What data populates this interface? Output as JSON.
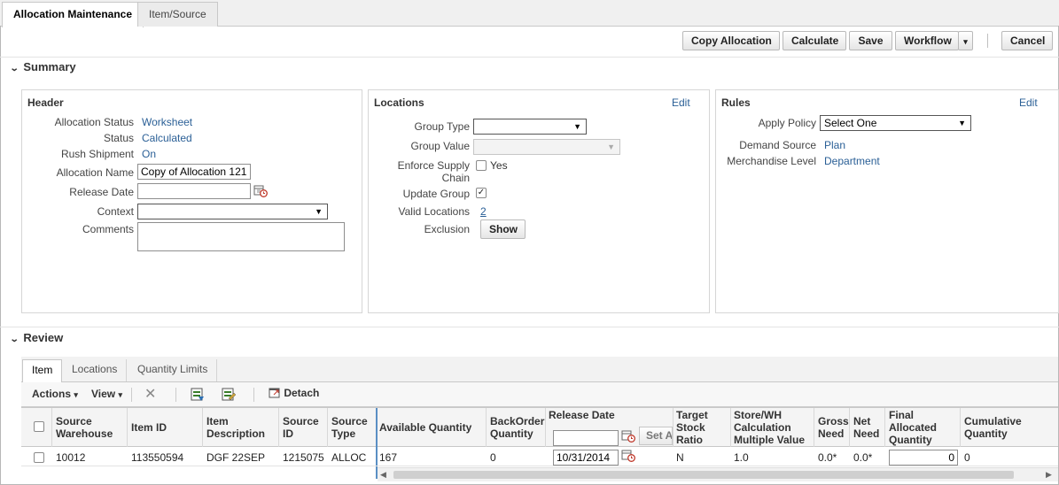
{
  "top_tabs": [
    {
      "label": "Allocation Maintenance"
    },
    {
      "label": "Item/Source"
    }
  ],
  "toolbar": {
    "copy": "Copy Allocation",
    "calculate": "Calculate",
    "save": "Save",
    "workflow": "Workflow",
    "cancel": "Cancel"
  },
  "summary": {
    "title": "Summary",
    "header": {
      "title": "Header",
      "allocation_status_label": "Allocation Status",
      "allocation_status": "Worksheet",
      "status_label": "Status",
      "status": "Calculated",
      "rush_label": "Rush Shipment",
      "rush": "On",
      "name_label": "Allocation Name",
      "name": "Copy of Allocation 121",
      "release_label": "Release Date",
      "release": "",
      "context_label": "Context",
      "context": "",
      "comments_label": "Comments",
      "comments": ""
    },
    "locations": {
      "title": "Locations",
      "edit": "Edit",
      "group_type_label": "Group Type",
      "group_type": "",
      "group_value_label": "Group Value",
      "group_value": "",
      "enforce_label_1": "Enforce Supply",
      "enforce_label_2": "Chain",
      "enforce_yes": "Yes",
      "update_group_label": "Update Group",
      "valid_locations_label": "Valid Locations",
      "valid_locations": "2",
      "exclusion_label": "Exclusion",
      "show": "Show"
    },
    "rules": {
      "title": "Rules",
      "edit": "Edit",
      "apply_policy_label": "Apply Policy",
      "apply_policy": "Select One",
      "demand_source_label": "Demand Source",
      "demand_source": "Plan",
      "merch_level_label": "Merchandise Level",
      "merch_level": "Department"
    }
  },
  "review": {
    "title": "Review",
    "tabs": [
      {
        "label": "Item"
      },
      {
        "label": "Locations"
      },
      {
        "label": "Quantity Limits"
      }
    ],
    "actions": "Actions",
    "view": "View",
    "detach": "Detach",
    "columns": {
      "source_warehouse": [
        "Source",
        "Warehouse"
      ],
      "item_id": "Item ID",
      "item_desc": [
        "Item",
        "Description"
      ],
      "source_id": [
        "Source",
        "ID"
      ],
      "source_type": [
        "Source",
        "Type"
      ],
      "available_qty": "Available Quantity",
      "backorder_qty": [
        "BackOrder",
        "Quantity"
      ],
      "release_date": "Release Date",
      "set_all": "Set A",
      "target_stock": [
        "Target",
        "Stock",
        "Ratio"
      ],
      "store_wh": [
        "Store/WH",
        "Calculation",
        "Multiple Value"
      ],
      "gross_need": [
        "Gross",
        "Need"
      ],
      "net_need": [
        "Net",
        "Need"
      ],
      "final_alloc": [
        "Final",
        "Allocated",
        "Quantity"
      ],
      "cumulative": [
        "Cumulative",
        "Quantity"
      ]
    },
    "rows": [
      {
        "source_warehouse": "10012",
        "item_id": "113550594",
        "item_desc": "DGF 22SEP",
        "source_id": "1215075",
        "source_type": "ALLOC",
        "available_qty": "167",
        "backorder_qty": "0",
        "release_date": "10/31/2014",
        "target_stock": "N",
        "store_wh": "1.0",
        "gross_need": "0.0*",
        "net_need": "0.0*",
        "final_alloc": "0",
        "cumulative": "0"
      }
    ]
  }
}
